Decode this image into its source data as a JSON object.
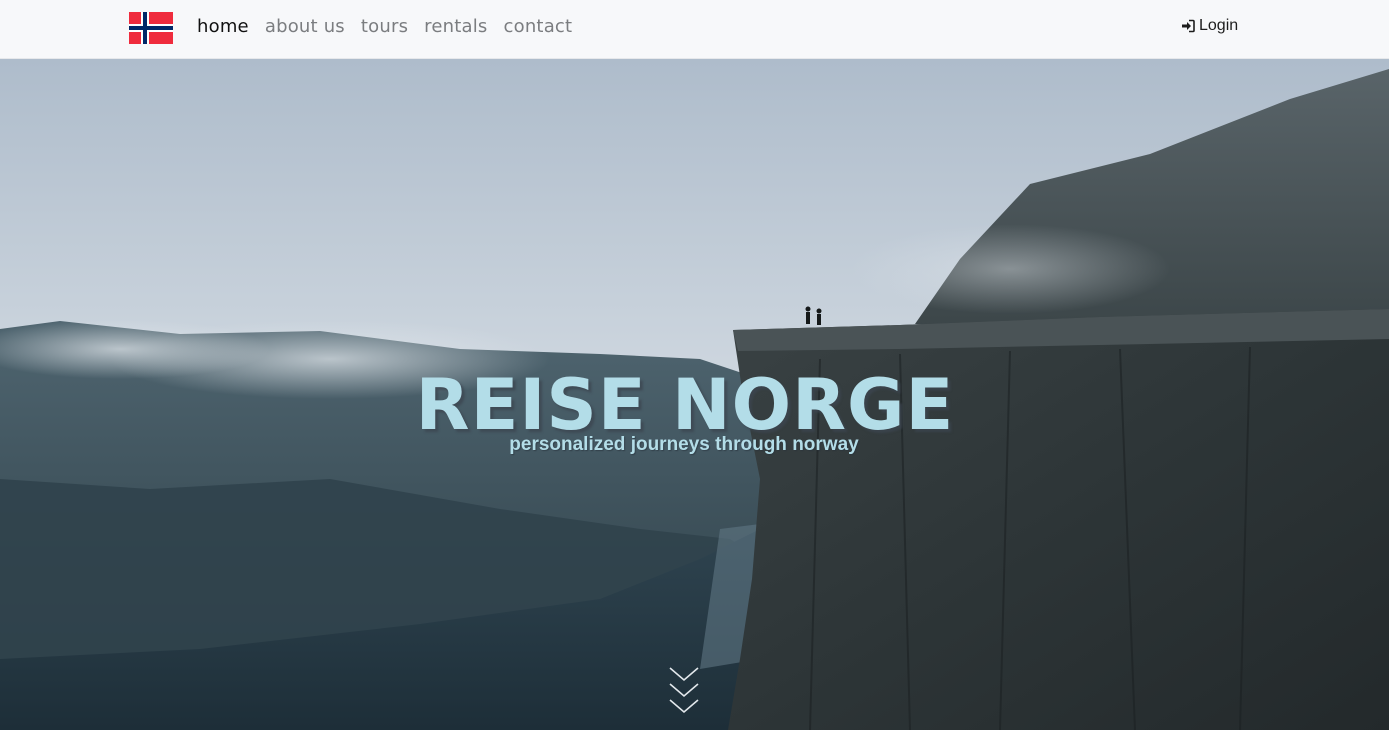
{
  "nav": {
    "flag_icon": "norway-flag-icon",
    "links": [
      {
        "label": "home",
        "active": true
      },
      {
        "label": "about us",
        "active": false
      },
      {
        "label": "tours",
        "active": false
      },
      {
        "label": "rentals",
        "active": false
      },
      {
        "label": "contact",
        "active": false
      }
    ],
    "login_icon": "sign-in-icon",
    "login_label": "Login"
  },
  "hero": {
    "title": "REISE NORGE",
    "subtitle": "personalized journeys through norway",
    "scroll_icon": "triple-chevron-down-icon"
  },
  "colors": {
    "navbar_bg": "#f7f8fa",
    "nav_active": "#111111",
    "nav_inactive": "#7b7d80",
    "hero_text": "#b3dde8",
    "flag_red": "#ef2b3d",
    "flag_blue": "#002868"
  }
}
